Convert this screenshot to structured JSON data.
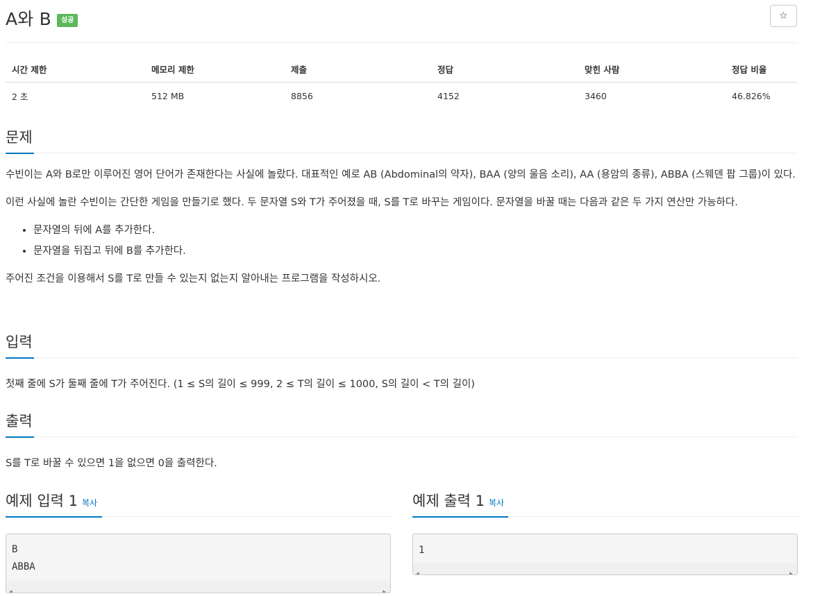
{
  "problem": {
    "title": "A와 B",
    "badge": "성공"
  },
  "star_icon": "☆",
  "info_table": {
    "headers": [
      "시간 제한",
      "메모리 제한",
      "제출",
      "정답",
      "맞힌 사람",
      "정답 비율"
    ],
    "values": [
      "2 초",
      "512 MB",
      "8856",
      "4152",
      "3460",
      "46.826%"
    ]
  },
  "sections": {
    "problem": {
      "heading": "문제",
      "para1": "수빈이는 A와 B로만 이루어진 영어 단어가 존재한다는 사실에 놀랐다. 대표적인 예로 AB (Abdominal의 약자), BAA (양의 울음 소리), AA (용암의 종류), ABBA (스웨덴 팝 그룹)이 있다.",
      "para2": "이런 사실에 놀란 수빈이는 간단한 게임을 만들기로 했다. 두 문자열 S와 T가 주어졌을 때, S를 T로 바꾸는 게임이다. 문자열을 바꿀 때는 다음과 같은 두 가지 연산만 가능하다.",
      "bullets": [
        "문자열의 뒤에 A를 추가한다.",
        "문자열을 뒤집고 뒤에 B를 추가한다."
      ],
      "para3": "주어진 조건을 이용해서 S를 T로 만들 수 있는지 없는지 알아내는 프로그램을 작성하시오."
    },
    "input": {
      "heading": "입력",
      "text": "첫째 줄에 S가 둘째 줄에 T가 주어진다. (1 ≤ S의 길이 ≤ 999, 2 ≤ T의 길이 ≤ 1000, S의 길이 < T의 길이)"
    },
    "output": {
      "heading": "출력",
      "text": "S를 T로 바꿀 수 있으면 1을 없으면 0을 출력한다."
    }
  },
  "samples": {
    "input": {
      "heading": "예제 입력 1",
      "copy": "복사",
      "lines": [
        "B",
        "ABBA"
      ]
    },
    "output": {
      "heading": "예제 출력 1",
      "copy": "복사",
      "lines": [
        "1"
      ]
    }
  },
  "scroll_icons": {
    "left": "◀",
    "right": "▶"
  }
}
